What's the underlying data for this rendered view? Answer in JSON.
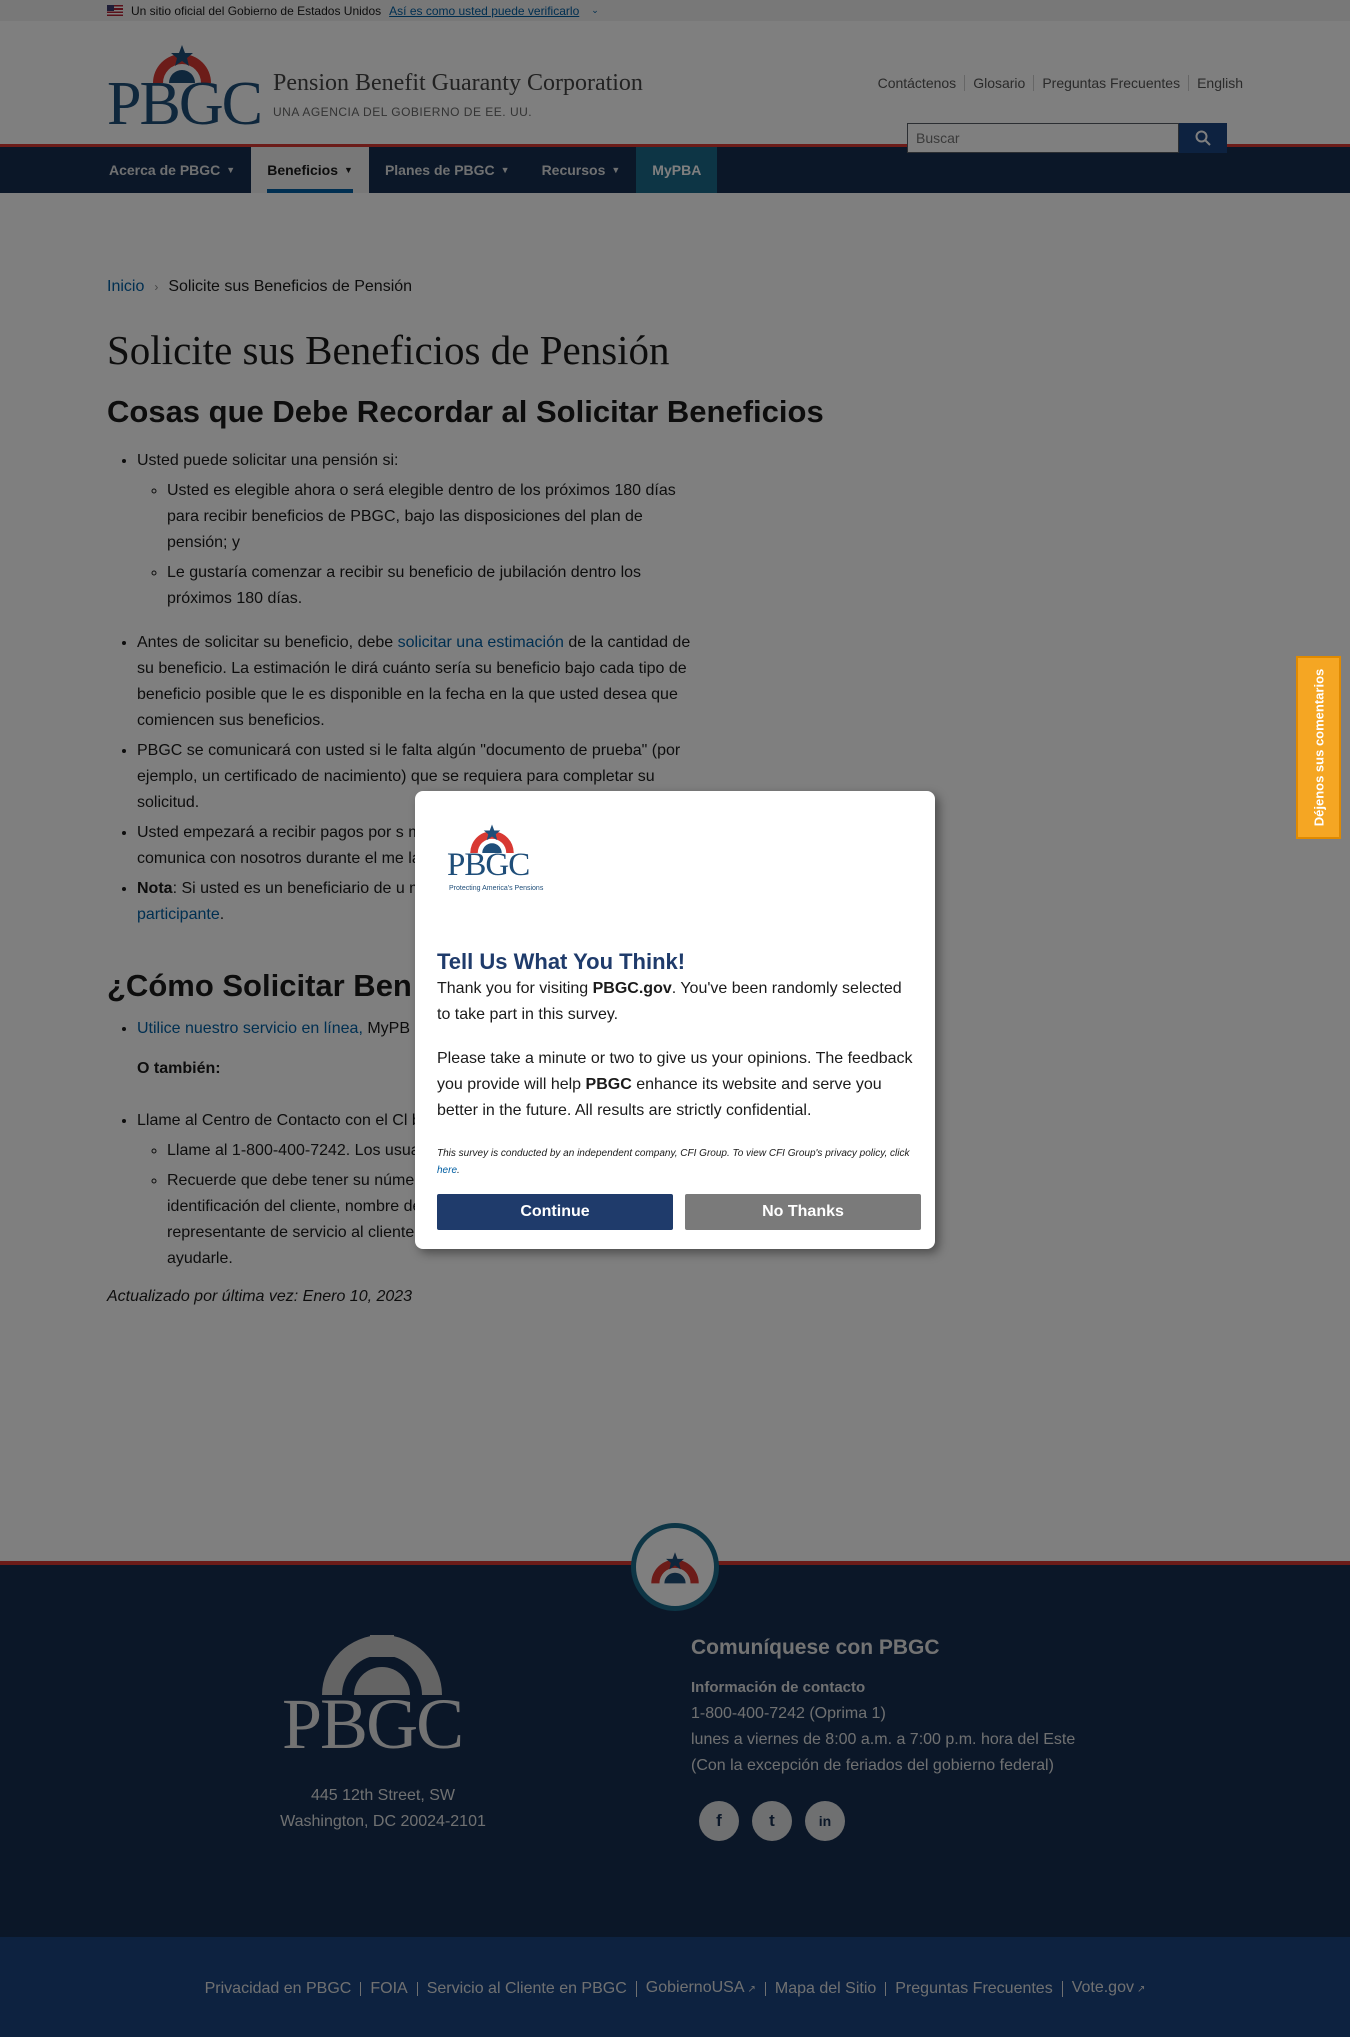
{
  "gov_banner": {
    "text": "Un sitio oficial del Gobierno de Estados Unidos",
    "link": "Así es como usted puede verificarlo"
  },
  "header": {
    "logo_text": "PBGC",
    "org_title": "Pension Benefit Guaranty Corporation",
    "org_subtitle": "UNA AGENCIA DEL GOBIERNO DE EE. UU.",
    "util_links": [
      "Contáctenos",
      "Glosario",
      "Preguntas Frecuentes",
      "English"
    ],
    "search_placeholder": "Buscar"
  },
  "nav": {
    "items": [
      {
        "label": "Acerca de PBGC"
      },
      {
        "label": "Beneficios"
      },
      {
        "label": "Planes de PBGC"
      },
      {
        "label": "Recursos"
      },
      {
        "label": "MyPBA"
      }
    ]
  },
  "breadcrumb": {
    "home": "Inicio",
    "current": "Solicite sus Beneficios de Pensión"
  },
  "main": {
    "page_title": "Solicite sus Beneficios de Pensión",
    "section1_title": "Cosas que Debe Recordar al Solicitar Beneficios",
    "b1": "Usted puede solicitar una pensión si:",
    "b1_sub1": "Usted es elegible ahora o será elegible dentro de los próximos 180 días para recibir beneficios de PBGC, bajo las disposiciones del plan de pensión; y",
    "b1_sub2": "Le gustaría comenzar a recibir su beneficio de jubilación dentro los próximos 180 días.",
    "b2_pre": "Antes de solicitar su beneficio, debe ",
    "b2_link": "solicitar una estimación",
    "b2_post": " de la cantidad de su beneficio. La estimación le dirá cuánto sería su beneficio bajo cada tipo de beneficio posible que le es disponible en la fecha en la que usted desea que comiencen sus beneficios.",
    "b3": "PBGC se comunicará con usted si le falta algún \"documento de prueba\" (por ejemplo, un certificado de nacimiento) que se requiera para completar su solicitud.",
    "b4": "Usted empezará a recibir pagos por s meses después de que se comunique comunica con nosotros durante el me la que puede comenzar su beneficio s",
    "b5_bold": "Nota",
    "b5_text": ": Si usted es un beneficiario de u mas informacion en ",
    "b5_link": "beneficiarios y có participante",
    "b5_end": ".",
    "section2_title": "¿Cómo Solicitar Ben",
    "c1_link": "Utilice nuestro servicio en línea,",
    "c1_text": " MyPB solicitud.",
    "o_tambien": "O también:",
    "c2": "Llame al Centro de Contacto con el Cl beneficios de pensión.",
    "c2_sub1": "Llame al 1-800-400-7242. Los usuarios de TTY/ASCII pueden llamar al 711.",
    "c2_sub2": "Recuerde que debe tener su número de Seguro Social, número de identificación del cliente, nombre del plan, y el número de caso listo para el representante de servicio al cliente esté en mejores condiciones de ayudarle.",
    "updated": "Actualizado por última vez: Enero 10, 2023"
  },
  "footer": {
    "logo_text": "PBGC",
    "address_line1": "445 12th Street, SW",
    "address_line2": "Washington, DC 20024-2101",
    "contact_heading": "Comuníquese con PBGC",
    "contact_label": "Información de contacto",
    "phone": "1-800-400-7242",
    "phone_note": " (Oprima 1)",
    "hours": "lunes a viernes de 8:00 a.m. a 7:00 p.m. hora del Este",
    "holidays": "(Con la excepción de feriados del gobierno federal)",
    "social": [
      "f",
      "t",
      "in"
    ],
    "bottom_links": [
      "Privacidad en PBGC",
      "FOIA",
      "Servicio al Cliente en PBGC",
      "GobiernoUSA",
      "Mapa del Sitio",
      "Preguntas Frecuentes",
      "Vote.gov"
    ]
  },
  "feedback_tab": "Déjenos sus comentarios",
  "modal": {
    "logo_text": "PBGC",
    "logo_tagline": "Protecting America's Pensions",
    "title": "Tell Us What You Think!",
    "p1_pre": "Thank you for visiting ",
    "p1_bold": "PBGC.gov",
    "p1_post": ". You've been randomly selected to take part in this survey.",
    "p2_pre": "Please take a minute or two to give us your opinions. The feedback you provide will help ",
    "p2_bold": "PBGC",
    "p2_post": " enhance its website and serve you better in the future. All results are strictly confidential.",
    "small_pre": "This survey is conducted by an independent company, CFI Group. To view CFI Group's privacy policy, click ",
    "small_link": "here",
    "small_post": ".",
    "continue": "Continue",
    "no_thanks": "No Thanks"
  },
  "colors": {
    "nav_bg": "#162e51",
    "accent_red": "#d83933",
    "link": "#005ea2",
    "modal_primary": "#1f3b6b",
    "feedback_tab": "#f5a623"
  }
}
